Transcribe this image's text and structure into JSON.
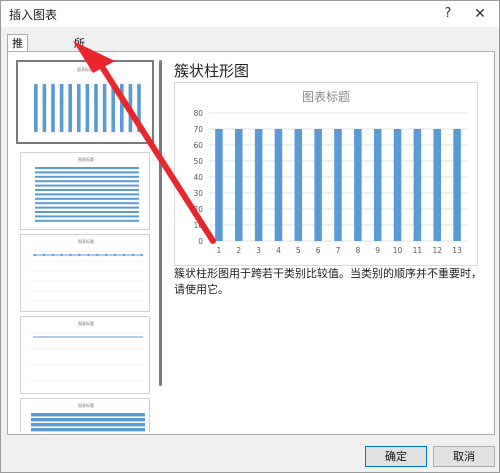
{
  "window": {
    "title": "插入图表",
    "help_label": "?",
    "close_label": "✕"
  },
  "tabs": [
    {
      "label": "推荐的图表",
      "active": true
    },
    {
      "label": "所有图表",
      "active": false
    }
  ],
  "thumbnails": [
    {
      "type": "clustered-column",
      "title": "图表标题",
      "selected": true
    },
    {
      "type": "clustered-bar",
      "title": "图表标题",
      "selected": false
    },
    {
      "type": "line-with-markers",
      "title": "图表标题",
      "selected": false
    },
    {
      "type": "line",
      "title": "图表标题",
      "selected": false
    },
    {
      "type": "stacked-bar",
      "title": "图表标题",
      "selected": false
    }
  ],
  "preview": {
    "heading": "簇状柱形图",
    "description": "簇状柱形图用于跨若干类别比较值。当类别的顺序并不重要时，请使用它。"
  },
  "chart_data": {
    "type": "bar",
    "title": "图表标题",
    "categories": [
      "1",
      "2",
      "3",
      "4",
      "5",
      "6",
      "7",
      "8",
      "9",
      "10",
      "11",
      "12",
      "13"
    ],
    "values": [
      70,
      70,
      70,
      70,
      70,
      70,
      70,
      70,
      70,
      70,
      70,
      70,
      70
    ],
    "ylim": [
      0,
      80
    ],
    "yticks": [
      0,
      10,
      20,
      30,
      40,
      50,
      60,
      70,
      80
    ],
    "grid": true,
    "bar_color": "#5b9bd5"
  },
  "buttons": {
    "ok_label": "确定",
    "cancel_label": "取消"
  },
  "annotation": {
    "arrow_color": "#e8262c"
  }
}
